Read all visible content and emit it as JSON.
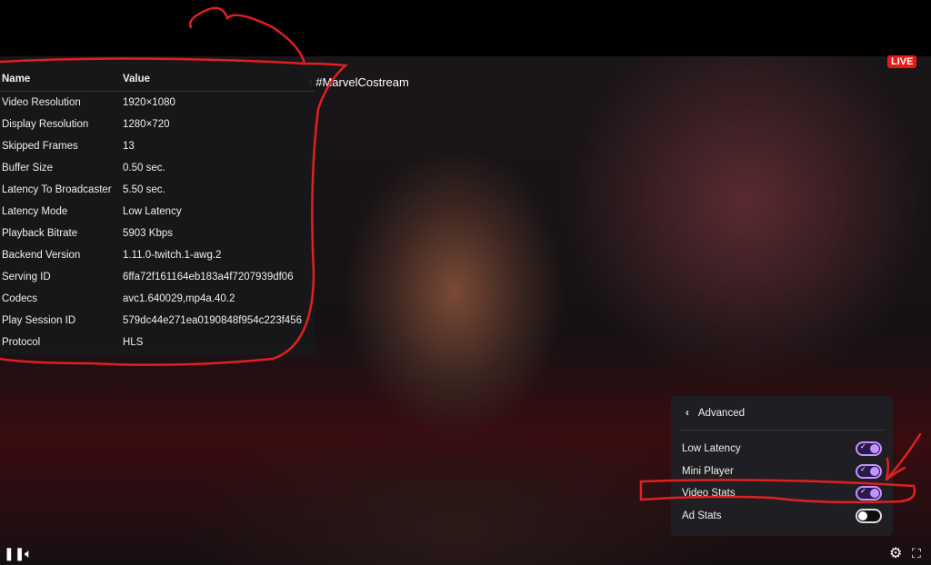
{
  "stream": {
    "title": "t #MarvelCostream",
    "live_badge": "LIVE"
  },
  "stats": {
    "headers": {
      "name": "Name",
      "value": "Value"
    },
    "rows": [
      {
        "name": "Video Resolution",
        "value": "1920×1080"
      },
      {
        "name": "Display Resolution",
        "value": "1280×720"
      },
      {
        "name": "Skipped Frames",
        "value": "13"
      },
      {
        "name": "Buffer Size",
        "value": "0.50 sec."
      },
      {
        "name": "Latency To Broadcaster",
        "value": "5.50 sec."
      },
      {
        "name": "Latency Mode",
        "value": "Low Latency"
      },
      {
        "name": "Playback Bitrate",
        "value": "5903 Kbps"
      },
      {
        "name": "Backend Version",
        "value": "1.11.0-twitch.1-awg.2"
      },
      {
        "name": "Serving ID",
        "value": "6ffa72f161164eb183a4f7207939df06"
      },
      {
        "name": "Codecs",
        "value": "avc1.640029,mp4a.40.2"
      },
      {
        "name": "Play Session ID",
        "value": "579dc44e271ea0190848f954c223f456"
      },
      {
        "name": "Protocol",
        "value": "HLS"
      }
    ]
  },
  "settings_menu": {
    "back_label": "Advanced",
    "items": [
      {
        "label": "Low Latency",
        "on": true
      },
      {
        "label": "Mini Player",
        "on": true
      },
      {
        "label": "Video Stats",
        "on": true
      },
      {
        "label": "Ad Stats",
        "on": false
      }
    ]
  },
  "controls": {
    "pause": "pause-icon",
    "volume": "volume-icon",
    "settings": "gear-icon",
    "exit_fullscreen": "exit-fullscreen-icon"
  },
  "colors": {
    "accent": "#bf94ff",
    "live": "#e91916",
    "annotation": "#e02020"
  }
}
